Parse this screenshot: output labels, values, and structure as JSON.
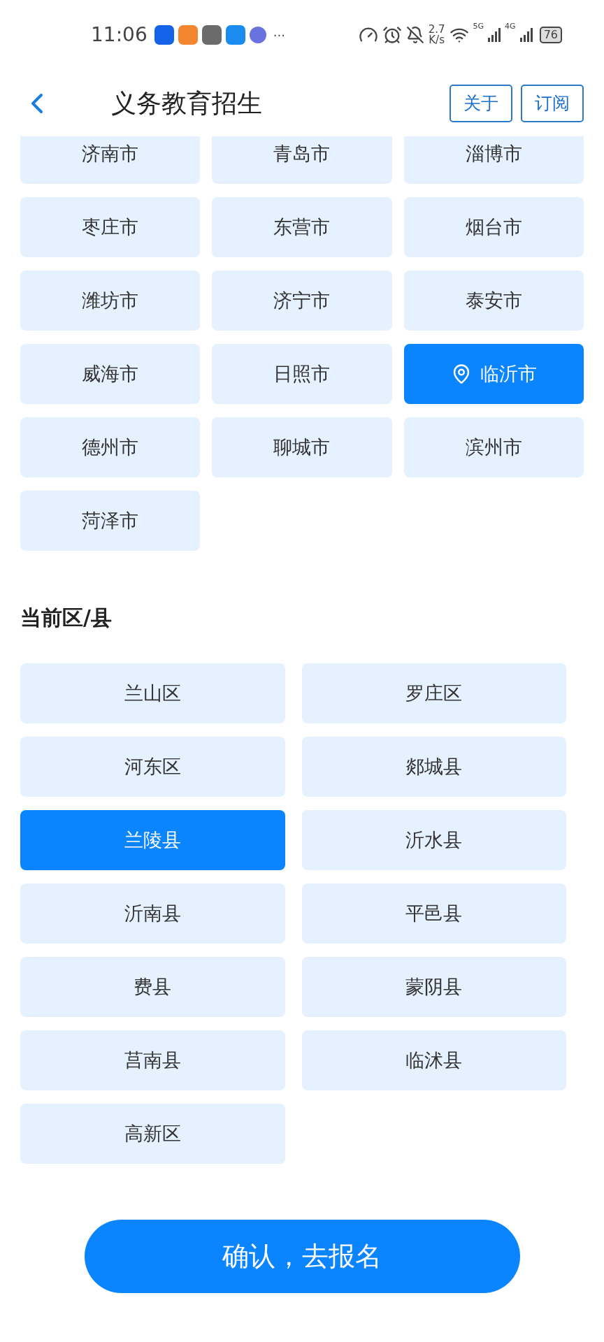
{
  "status_bar": {
    "time": "11:06",
    "more": "···",
    "speed_value": "2.7",
    "speed_unit": "K/s",
    "sim1": "5G",
    "sim2": "4G",
    "battery": "76"
  },
  "header": {
    "title": "义务教育招生",
    "buttons": [
      "关于",
      "订阅"
    ]
  },
  "cities": [
    {
      "name": "济南市",
      "selected": false
    },
    {
      "name": "青岛市",
      "selected": false
    },
    {
      "name": "淄博市",
      "selected": false
    },
    {
      "name": "枣庄市",
      "selected": false
    },
    {
      "name": "东营市",
      "selected": false
    },
    {
      "name": "烟台市",
      "selected": false
    },
    {
      "name": "潍坊市",
      "selected": false
    },
    {
      "name": "济宁市",
      "selected": false
    },
    {
      "name": "泰安市",
      "selected": false
    },
    {
      "name": "威海市",
      "selected": false
    },
    {
      "name": "日照市",
      "selected": false
    },
    {
      "name": "临沂市",
      "selected": true
    },
    {
      "name": "德州市",
      "selected": false
    },
    {
      "name": "聊城市",
      "selected": false
    },
    {
      "name": "滨州市",
      "selected": false
    },
    {
      "name": "菏泽市",
      "selected": false
    }
  ],
  "districts": {
    "heading": "当前区/县",
    "items": [
      {
        "name": "兰山区",
        "selected": false
      },
      {
        "name": "罗庄区",
        "selected": false
      },
      {
        "name": "河东区",
        "selected": false
      },
      {
        "name": "郯城县",
        "selected": false
      },
      {
        "name": "兰陵县",
        "selected": true
      },
      {
        "name": "沂水县",
        "selected": false
      },
      {
        "name": "沂南县",
        "selected": false
      },
      {
        "name": "平邑县",
        "selected": false
      },
      {
        "name": "费县",
        "selected": false
      },
      {
        "name": "蒙阴县",
        "selected": false
      },
      {
        "name": "莒南县",
        "selected": false
      },
      {
        "name": "临沭县",
        "selected": false
      },
      {
        "name": "高新区",
        "selected": false
      }
    ]
  },
  "confirm_button": "确认，去报名"
}
